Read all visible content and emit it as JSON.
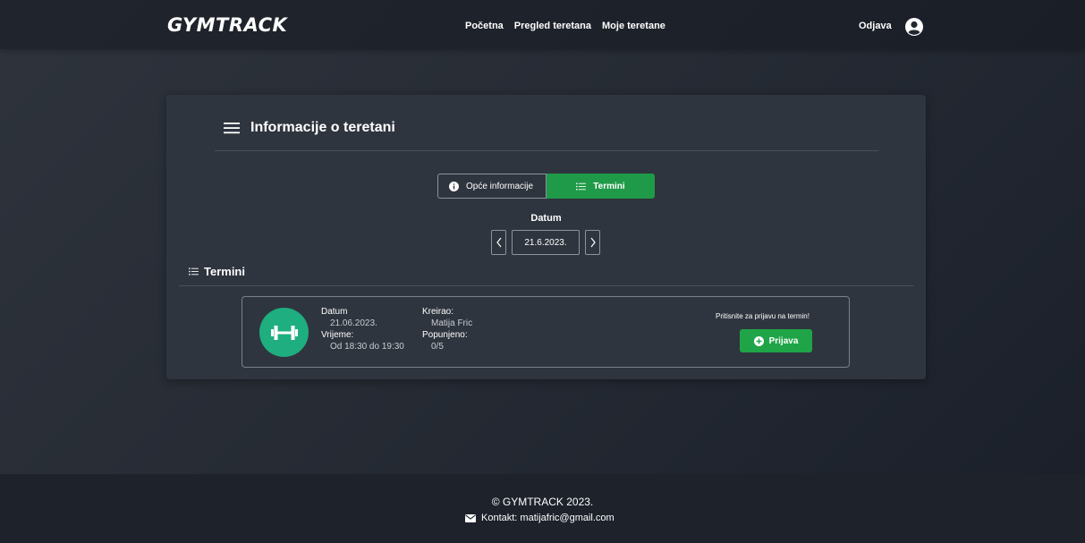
{
  "navbar": {
    "brand": "GYMTRACK",
    "links": [
      "Početna",
      "Pregled teretana",
      "Moje teretane"
    ],
    "logout_label": "Odjava",
    "user_icon": "user-circle-icon"
  },
  "card": {
    "title": "Informacije o teretani",
    "tabs": [
      {
        "label": "Opće informacije",
        "icon": "info-icon",
        "active": false
      },
      {
        "label": "Termini",
        "icon": "list-icon",
        "active": true
      }
    ],
    "date_label": "Datum",
    "date_value": "21.6.2023.",
    "section_title": "Termini"
  },
  "term": {
    "date_label": "Datum",
    "date_value": "21.06.2023.",
    "time_label": "Vrijeme:",
    "time_value": "Od 18:30 do 19:30",
    "creator_label": "Kreirao:",
    "creator_value": "Matija Fric",
    "filled_label": "Popunjeno:",
    "filled_value": "0/5",
    "cta_text": "Pritisnite za prijavu na termin!",
    "join_label": "Prijava"
  },
  "footer": {
    "copyright": "© GYMTRACK 2023.",
    "contact": "Kontakt: matijafric@gmail.com"
  },
  "colors": {
    "accent": "#1f9a48",
    "icon_bg": "#1fae7f",
    "card_bg": "#2f353e"
  }
}
